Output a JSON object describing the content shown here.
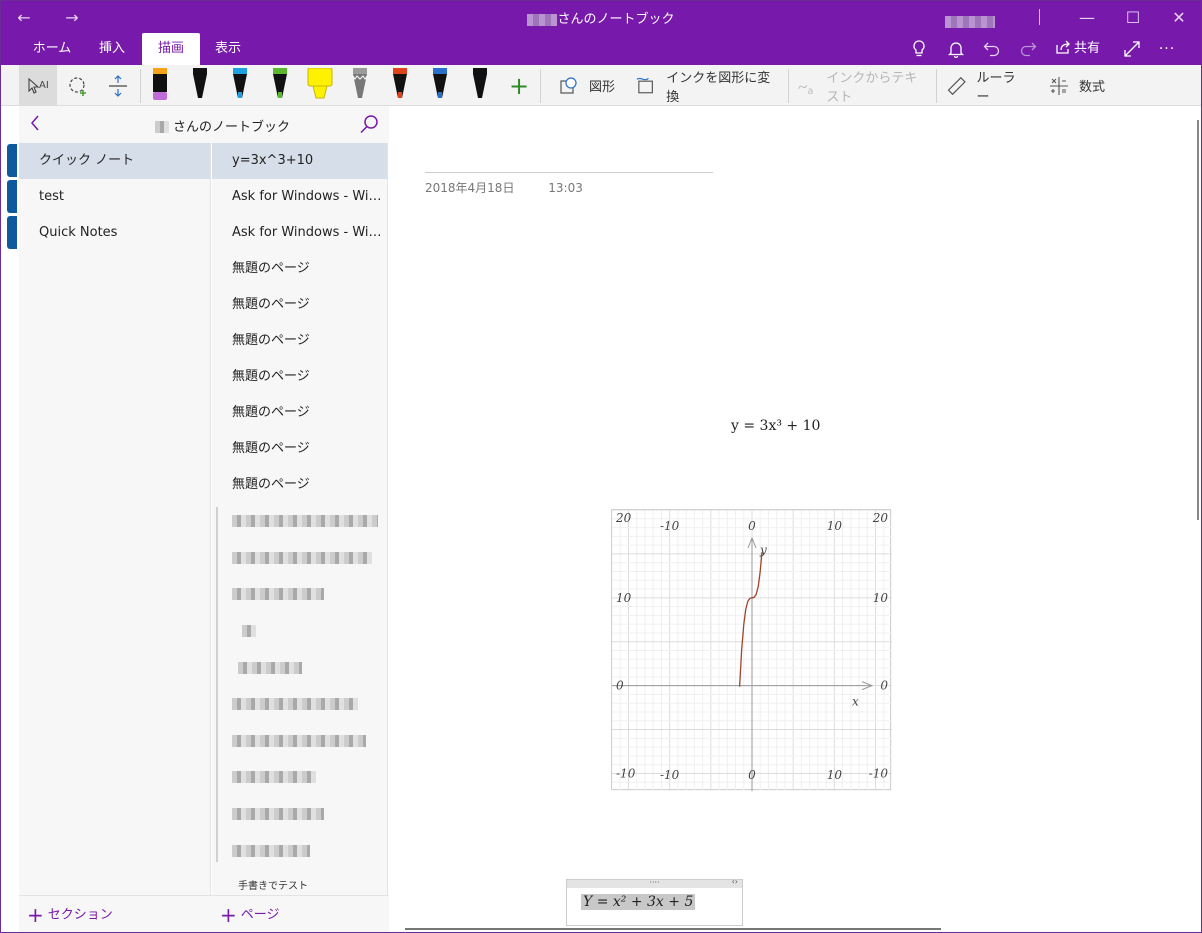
{
  "window": {
    "title_suffix": "さんのノートブック",
    "nav_back": "←",
    "nav_forward": "→",
    "minimize": "—",
    "maximize": "☐",
    "close": "✕"
  },
  "ribbon": {
    "tabs": [
      {
        "label": "ホーム"
      },
      {
        "label": "挿入"
      },
      {
        "label": "描画",
        "active": true
      },
      {
        "label": "表示"
      }
    ],
    "share_label": "共有",
    "more": "···"
  },
  "toolbar": {
    "shapes_label": "図形",
    "ink_to_shape_label": "インクを図形に変換",
    "ink_to_text_label": "インクからテキスト",
    "ruler_label": "ルーラー",
    "math_label": "数式",
    "add_pen": "+",
    "pens": [
      {
        "icon": "pen-icon",
        "color": "#111111",
        "band": "#f7a21b",
        "type": "highlighter-black"
      },
      {
        "icon": "pen-icon",
        "color": "#111111",
        "band": "#111111"
      },
      {
        "icon": "pen-icon",
        "color": "#111111",
        "band": "#1fa1e0"
      },
      {
        "icon": "pen-icon",
        "color": "#111111",
        "band": "#5bb82e"
      },
      {
        "icon": "highlighter-icon",
        "color": "#fff200",
        "band": "#fff200"
      },
      {
        "icon": "pencil-icon",
        "color": "#777777",
        "band": "#9a9a9a"
      },
      {
        "icon": "pen-icon",
        "color": "#111111",
        "band": "#e0441c"
      },
      {
        "icon": "pen-icon",
        "color": "#111111",
        "band": "#2a6fc9"
      },
      {
        "icon": "pen-icon",
        "color": "#111111",
        "band": "#111111"
      }
    ]
  },
  "nav": {
    "notebook_suffix": "さんのノートブック",
    "sections": [
      {
        "label": "クイック ノート",
        "active": true
      },
      {
        "label": "test"
      },
      {
        "label": "Quick Notes"
      }
    ],
    "pages": [
      {
        "label": "y=3x^3+10",
        "active": true
      },
      {
        "label": "Ask for Windows - Win..."
      },
      {
        "label": "Ask for Windows - Win..."
      },
      {
        "label": "無題のページ"
      },
      {
        "label": "無題のページ"
      },
      {
        "label": "無題のページ"
      },
      {
        "label": "無題のページ"
      },
      {
        "label": "無題のページ"
      },
      {
        "label": "無題のページ"
      },
      {
        "label": "無題のページ"
      }
    ],
    "handwriting_page": "手書きでテスト",
    "add_section": "セクション",
    "add_page": "ページ"
  },
  "page": {
    "date": "2018年4月18日",
    "time": "13:03",
    "equation_display": "y = 3x³ + 10",
    "math_input": "Y = x² + 3x + 5"
  },
  "chart_data": {
    "type": "line",
    "title": "",
    "xlabel": "x",
    "ylabel": "y",
    "xlim": [
      -17,
      17
    ],
    "ylim": [
      -12,
      20
    ],
    "x_ticks": [
      -10,
      0,
      10
    ],
    "y_ticks": [
      -10,
      0,
      10,
      20
    ],
    "grid": true,
    "series": [
      {
        "color": "#a0442a",
        "function": "y = 3x^3 + 10",
        "x": [
          -1.5,
          -1.25,
          -1.0,
          -0.75,
          -0.5,
          -0.25,
          0,
          0.25,
          0.5,
          0.75,
          1.0,
          1.2
        ],
        "y": [
          -0.125,
          4.14,
          7.0,
          8.73,
          9.625,
          9.95,
          10,
          10.05,
          10.375,
          11.27,
          13.0,
          15.18
        ]
      }
    ]
  }
}
